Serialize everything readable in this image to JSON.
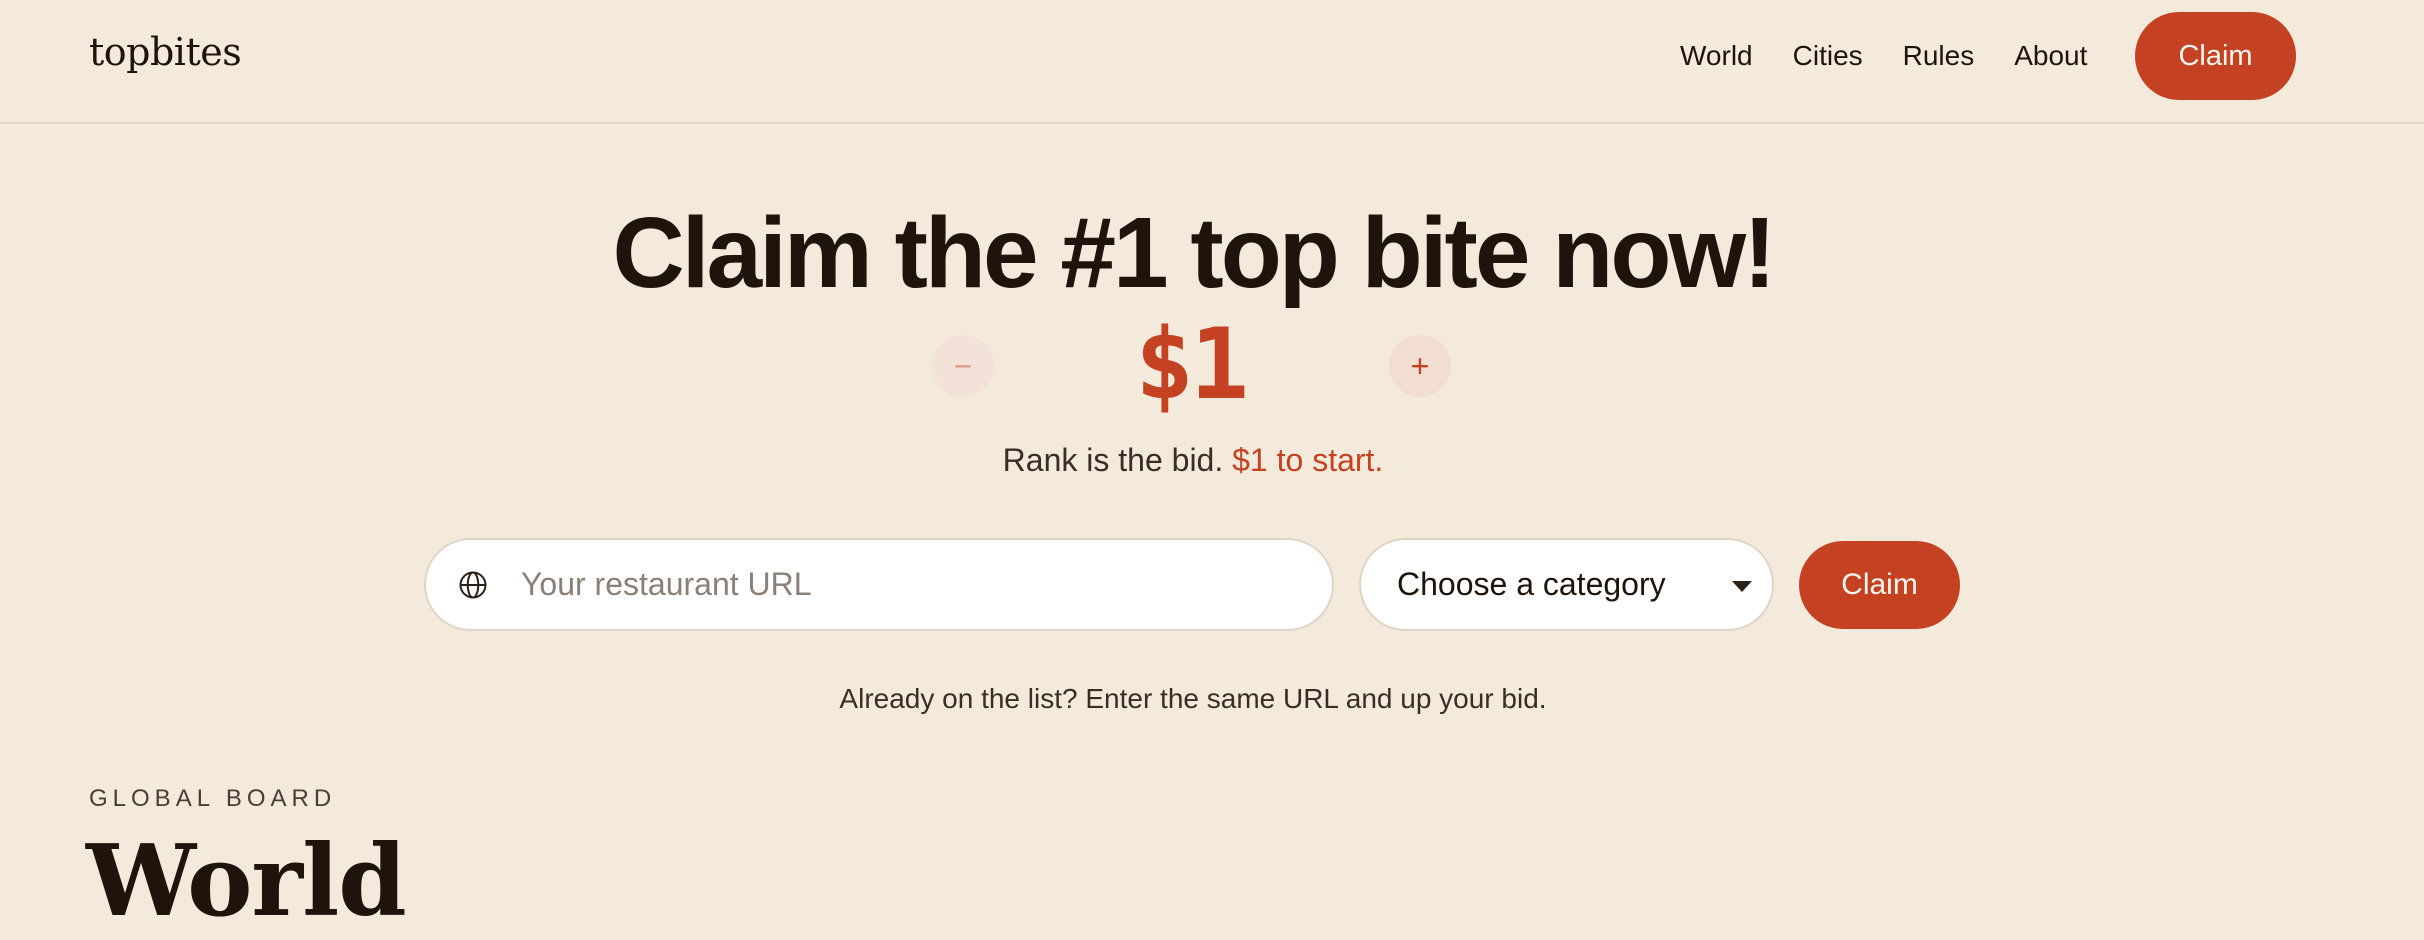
{
  "header": {
    "logo": "topbites",
    "nav": [
      "World",
      "Cities",
      "Rules",
      "About"
    ],
    "claim_label": "Claim"
  },
  "hero": {
    "title": "Claim the #1 top bite now!",
    "price": "$1",
    "minus_symbol": "−",
    "plus_symbol": "+",
    "rank_text": "Rank is the bid.",
    "rank_accent": "$1 to start."
  },
  "form": {
    "url_placeholder": "Your restaurant URL",
    "url_value": "",
    "category_label": "Choose a category",
    "claim_label": "Claim",
    "helper": "Already on the list? Enter the same URL and up your bid."
  },
  "board": {
    "eyebrow": "GLOBAL BOARD",
    "title": "World"
  },
  "icons": {
    "globe": "globe-icon",
    "chevron": "chevron-down-icon"
  },
  "colors": {
    "background": "#f4eadc",
    "accent": "#c44222",
    "text": "#1e140c"
  }
}
